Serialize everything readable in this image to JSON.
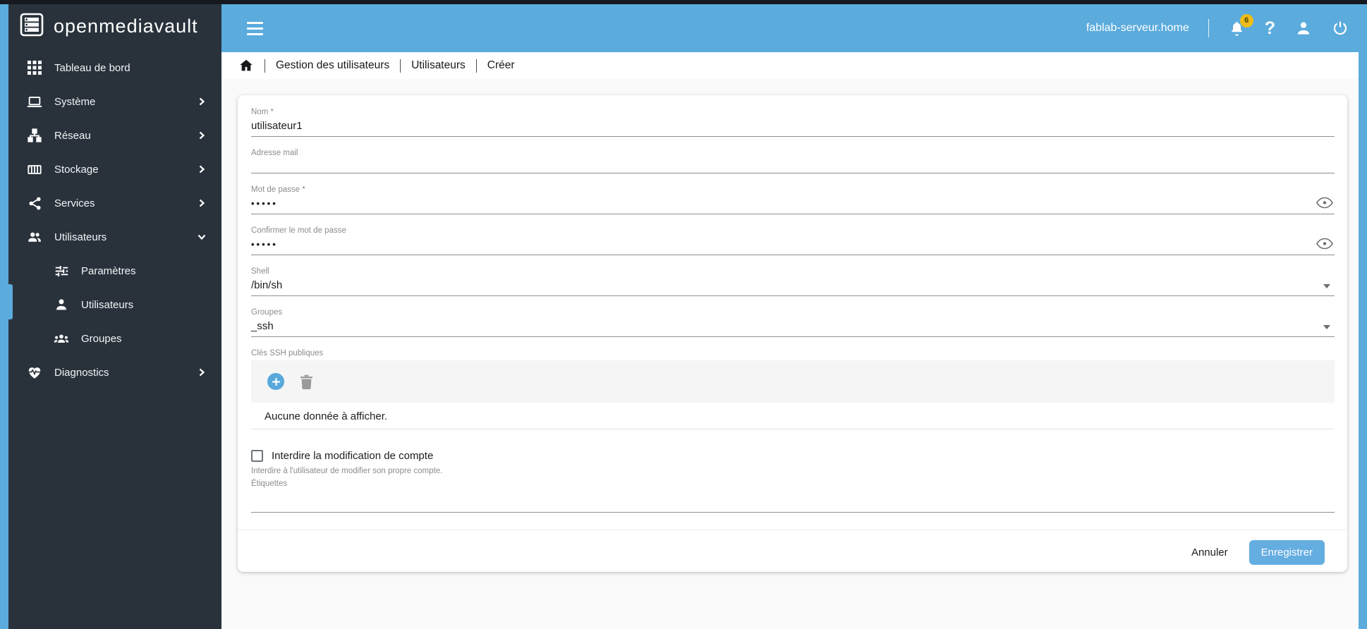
{
  "brand": {
    "name": "openmediavault"
  },
  "topbar": {
    "hostname": "fablab-serveur.home",
    "notifications_count": "6",
    "icons": [
      "bell-icon",
      "help-icon",
      "user-icon",
      "power-icon"
    ]
  },
  "breadcrumb": {
    "items": [
      "Gestion des utilisateurs",
      "Utilisateurs",
      "Créer"
    ]
  },
  "sidebar": {
    "items": [
      {
        "label": "Tableau de bord",
        "icon": "dashboard-grid-icon"
      },
      {
        "label": "Système",
        "icon": "laptop-icon",
        "chevron": "right"
      },
      {
        "label": "Réseau",
        "icon": "network-icon",
        "chevron": "right"
      },
      {
        "label": "Stockage",
        "icon": "storage-icon",
        "chevron": "right"
      },
      {
        "label": "Services",
        "icon": "share-icon",
        "chevron": "right"
      },
      {
        "label": "Utilisateurs",
        "icon": "people-icon",
        "chevron": "down",
        "expanded": true
      },
      {
        "label": "Paramètres",
        "icon": "tune-icon",
        "sub": true
      },
      {
        "label": "Utilisateurs",
        "icon": "person-icon",
        "sub": true,
        "active": true
      },
      {
        "label": "Groupes",
        "icon": "groups-icon",
        "sub": true
      },
      {
        "label": "Diagnostics",
        "icon": "heart-pulse-icon",
        "chevron": "right"
      }
    ]
  },
  "form": {
    "nom": {
      "label": "Nom *",
      "value": "utilisateur1"
    },
    "adresse_mail": {
      "label": "Adresse mail",
      "value": ""
    },
    "mot_de_passe": {
      "label": "Mot de passe *",
      "value": "•••••"
    },
    "confirmer": {
      "label": "Confirmer le mot de passe",
      "value": "•••••"
    },
    "shell": {
      "label": "Shell",
      "value": "/bin/sh"
    },
    "groupes": {
      "label": "Groupes",
      "value": "_ssh"
    },
    "ssh": {
      "label": "Clés SSH publiques",
      "empty_text": "Aucune donnée à afficher."
    },
    "interdire": {
      "label": "Interdire la modification de compte",
      "helper": "Interdire à l'utilisateur de modifier son propre compte.",
      "checked": false
    },
    "etiquettes": {
      "label": "Étiquettes",
      "value": ""
    }
  },
  "actions": {
    "cancel": "Annuler",
    "save": "Enregistrer"
  },
  "colors": {
    "accent": "#5babdd",
    "sidebar_bg": "#29323b",
    "save_button": "#64ade1",
    "badge": "#eebd18",
    "field_label": "#8c8c8c"
  }
}
